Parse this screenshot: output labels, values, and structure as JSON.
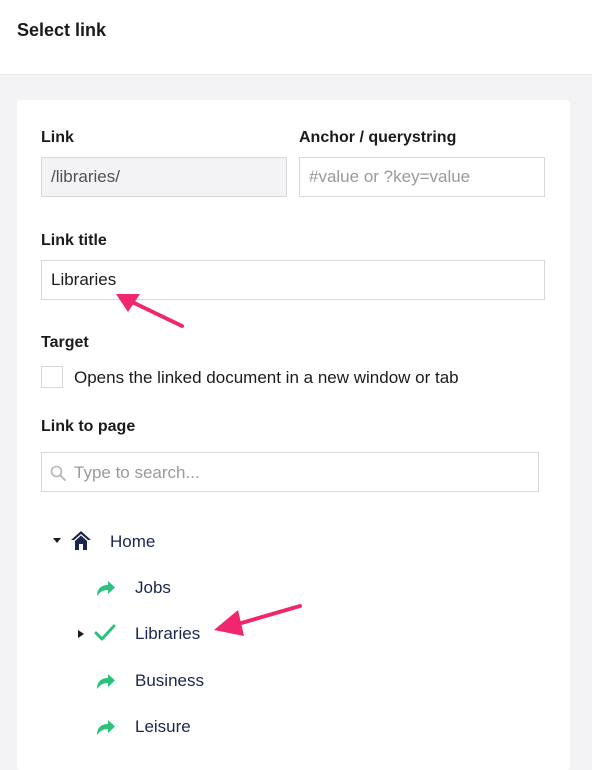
{
  "header": {
    "title": "Select link"
  },
  "form": {
    "link": {
      "label": "Link",
      "value": "/libraries/"
    },
    "anchor": {
      "label": "Anchor / querystring",
      "placeholder": "#value or ?key=value"
    },
    "link_title": {
      "label": "Link title",
      "value": "Libraries"
    },
    "target": {
      "label": "Target",
      "checkbox_label": "Opens the linked document in a new window or tab",
      "checked": false
    },
    "link_to_page": {
      "label": "Link to page",
      "search_placeholder": "Type to search..."
    }
  },
  "tree": {
    "root": {
      "label": "Home",
      "icon": "home-icon",
      "expanded": true
    },
    "children": [
      {
        "label": "Jobs",
        "icon": "redirect-arrow-icon"
      },
      {
        "label": "Libraries",
        "icon": "checkmark-icon",
        "selected": true,
        "has_children": true
      },
      {
        "label": "Business",
        "icon": "redirect-arrow-icon"
      },
      {
        "label": "Leisure",
        "icon": "redirect-arrow-icon"
      }
    ]
  },
  "colors": {
    "accent_annotation": "#f0266e",
    "redirect_icon": "#2bc37c",
    "check_icon": "#2bc37c",
    "tree_text": "#1b264f"
  }
}
